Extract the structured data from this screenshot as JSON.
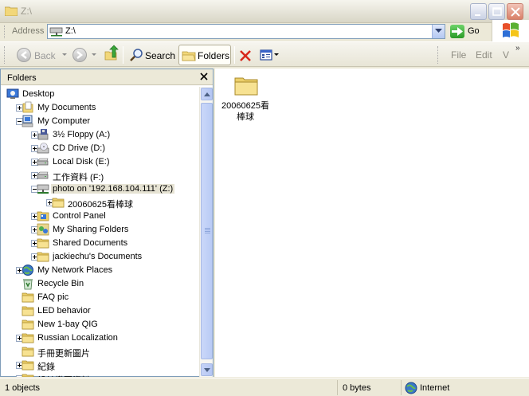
{
  "window": {
    "title": "Z:\\"
  },
  "address": {
    "label": "Address",
    "value": "Z:\\",
    "go_label": "Go"
  },
  "toolbar": {
    "back_label": "Back",
    "search_label": "Search",
    "folders_label": "Folders",
    "menu": [
      "File",
      "Edit",
      "V"
    ]
  },
  "folders_pane": {
    "title": "Folders",
    "tree": [
      {
        "label": "Desktop",
        "icon": "desktop-icon",
        "level": 0,
        "expander": "none"
      },
      {
        "label": "My Documents",
        "icon": "my-documents-icon",
        "level": 1,
        "expander": "plus"
      },
      {
        "label": "My Computer",
        "icon": "my-computer-icon",
        "level": 1,
        "expander": "minus"
      },
      {
        "label": "3½ Floppy (A:)",
        "icon": "floppy-icon",
        "level": 2,
        "expander": "plus"
      },
      {
        "label": "CD Drive (D:)",
        "icon": "cd-drive-icon",
        "level": 2,
        "expander": "plus"
      },
      {
        "label": "Local Disk (E:)",
        "icon": "local-disk-icon",
        "level": 2,
        "expander": "plus"
      },
      {
        "label": "工作資料 (F:)",
        "icon": "local-disk-icon",
        "level": 2,
        "expander": "plus"
      },
      {
        "label": "photo on '192.168.104.111' (Z:)",
        "icon": "network-drive-icon",
        "level": 2,
        "expander": "minus",
        "selected": true
      },
      {
        "label": "20060625看棒球",
        "icon": "folder-icon",
        "level": 3,
        "expander": "plus"
      },
      {
        "label": "Control Panel",
        "icon": "control-panel-icon",
        "level": 2,
        "expander": "plus"
      },
      {
        "label": "My Sharing Folders",
        "icon": "sharing-folders-icon",
        "level": 2,
        "expander": "plus"
      },
      {
        "label": "Shared Documents",
        "icon": "folder-icon",
        "level": 2,
        "expander": "plus"
      },
      {
        "label": "jackiechu's Documents",
        "icon": "folder-icon",
        "level": 2,
        "expander": "plus"
      },
      {
        "label": "My Network Places",
        "icon": "network-places-icon",
        "level": 1,
        "expander": "plus"
      },
      {
        "label": "Recycle Bin",
        "icon": "recycle-bin-icon",
        "level": 1,
        "expander": "none"
      },
      {
        "label": "FAQ pic",
        "icon": "folder-icon",
        "level": 1,
        "expander": "none"
      },
      {
        "label": "LED behavior",
        "icon": "folder-icon",
        "level": 1,
        "expander": "none"
      },
      {
        "label": "New 1-bay QIG",
        "icon": "folder-icon",
        "level": 1,
        "expander": "none"
      },
      {
        "label": "Russian Localization",
        "icon": "folder-icon",
        "level": 1,
        "expander": "plus"
      },
      {
        "label": "手冊更新圖片",
        "icon": "folder-icon",
        "level": 1,
        "expander": "none"
      },
      {
        "label": "紀錄",
        "icon": "folder-icon",
        "level": 1,
        "expander": "plus"
      },
      {
        "label": "設計變更資料",
        "icon": "folder-icon",
        "level": 1,
        "expander": "plus"
      }
    ]
  },
  "content": {
    "items": [
      {
        "name": "20060625看棒球",
        "icon": "folder-icon"
      }
    ]
  },
  "status": {
    "objects": "1 objects",
    "size": "0 bytes",
    "zone": "Internet"
  },
  "colors": {
    "selection": "#e6e3d3",
    "chrome": "#ece9d8",
    "border": "#7f9db9"
  }
}
